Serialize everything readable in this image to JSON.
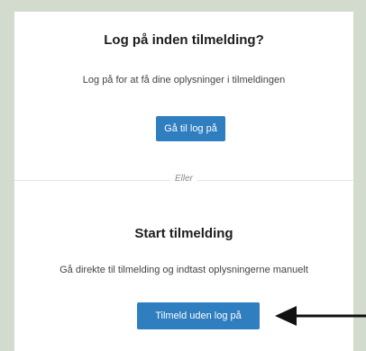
{
  "login_section": {
    "title": "Log på inden tilmelding?",
    "description": "Log på for at få dine oplysninger i tilmeldingen",
    "button_label": "Gå til log på"
  },
  "divider": {
    "label": "Eller"
  },
  "start_section": {
    "title": "Start tilmelding",
    "description": "Gå direkte til tilmelding og indtast oplysningerne manuelt",
    "button_label": "Tilmeld uden log på"
  },
  "colors": {
    "background": "#d3dbcf",
    "card": "#ffffff",
    "button": "#2f7ec0",
    "arrow": "#111111"
  },
  "icons": {
    "pointer": "arrow-left-icon"
  }
}
